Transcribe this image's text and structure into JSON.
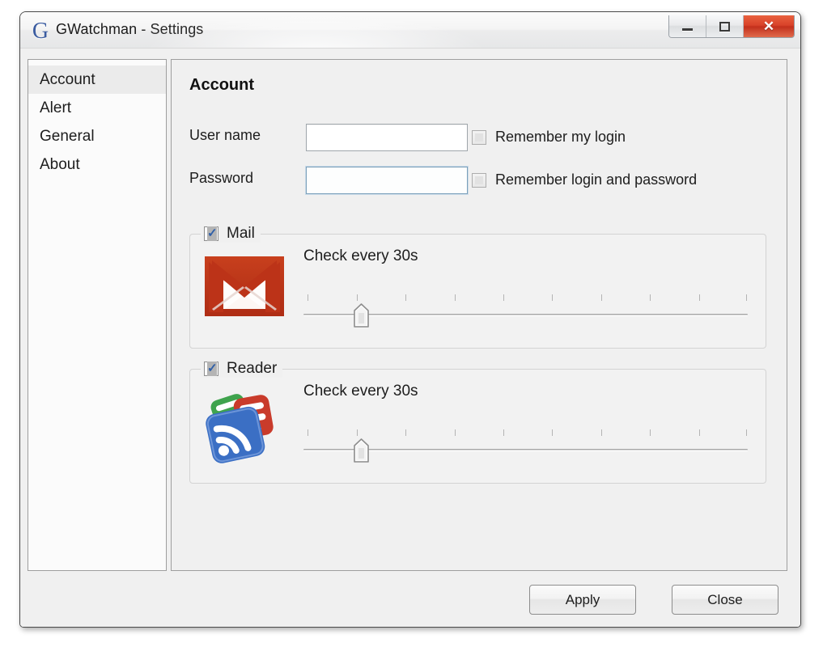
{
  "window": {
    "logo_icon": "google-g-icon",
    "app_name": "GWatchman",
    "title_separator": " - Settings",
    "controls": {
      "minimize_label": "Minimize",
      "maximize_label": "Restore",
      "close_label": "Close",
      "close_glyph": "✕"
    }
  },
  "sidebar": {
    "items": [
      {
        "label": "Account",
        "selected": true
      },
      {
        "label": "Alert",
        "selected": false
      },
      {
        "label": "General",
        "selected": false
      },
      {
        "label": "About",
        "selected": false
      }
    ]
  },
  "main": {
    "page_title": "Account",
    "fields": [
      {
        "label": "User name",
        "value": "",
        "placeholder": "",
        "focused": false
      },
      {
        "label": "Password",
        "value": "",
        "placeholder": "",
        "focused": true
      }
    ],
    "options": [
      {
        "label": "Remember my login",
        "checked": false
      },
      {
        "label": "Remember login and password",
        "checked": false
      }
    ],
    "groups": [
      {
        "name": "Mail",
        "checked": true,
        "icon": "gmail-envelope-icon",
        "interval_label": "Check every 30s",
        "interval_seconds": 30,
        "slider": {
          "ticks": 10,
          "thumb_percent": 13
        }
      },
      {
        "name": "Reader",
        "checked": true,
        "icon": "google-reader-icon",
        "interval_label": "Check every 30s",
        "interval_seconds": 30,
        "slider": {
          "ticks": 10,
          "thumb_percent": 13
        }
      }
    ]
  },
  "footer": {
    "apply_label": "Apply",
    "close_label": "Close"
  },
  "colors": {
    "accent_blue": "#2f5fa8",
    "close_red": "#c3301c",
    "gmail_red": "#bc3318",
    "reader_blue": "#3b6fc4",
    "reader_green": "#3fa34d",
    "reader_red": "#c93b2b",
    "window_bg": "#f0f0f0"
  }
}
